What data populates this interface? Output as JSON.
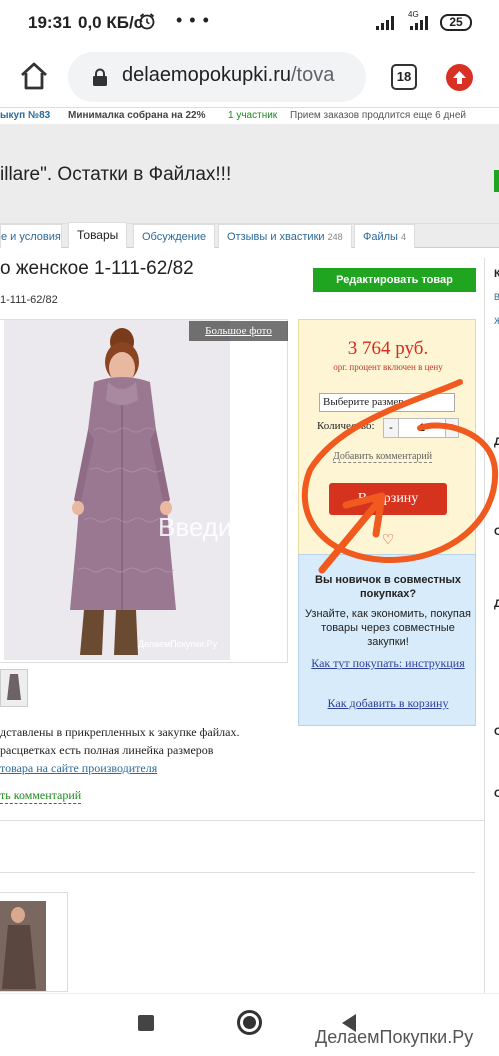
{
  "status": {
    "time": "19:31",
    "speed": "0,0 КБ/с",
    "alarm_icon": "alarm-icon",
    "more_dots": "• • •",
    "network": "4G",
    "battery": "25"
  },
  "browser": {
    "url_host": "delaemopokupki.ru",
    "url_path": "/tova",
    "tabs_count": "18"
  },
  "page": {
    "top_strip": [
      "ыкуп №83",
      "Минималка собрана на 22%",
      "1 участник",
      "Прием заказов продлится еще 6 дней"
    ],
    "purchase_title": "illare\". Остатки в Файлах!!!",
    "tabs": [
      {
        "label": "е и условия",
        "count": ""
      },
      {
        "label": "Товары",
        "count": ""
      },
      {
        "label": "Обсуждение",
        "count": ""
      },
      {
        "label": "Отзывы и хвастики",
        "count": "248"
      },
      {
        "label": "Файлы",
        "count": "4"
      }
    ],
    "product_title": "о женское 1-111-62/82",
    "product_sub": "1-111-62/82",
    "edit_button": "Редактировать товар",
    "big_photo": "Бoльшое фото",
    "photo_watermark": "ДелаемПокупки.Ру",
    "photo_overlay": "Введи...",
    "description_lines": [
      "дставлены в прикрепленных к закупке файлах.",
      "расцветках есть полная линейка размеров"
    ],
    "description_link": "товара на сайте производителя",
    "add_comment_bottom": "ть комментарий",
    "price": {
      "amount": "3 764 руб.",
      "note": "орг. процент включен в цену",
      "size_select": "Выберите размер",
      "qty_label": "Количество:",
      "qty_minus": "-",
      "qty_value": "1",
      "qty_plus": "+",
      "add_comment": "Добавить комментарий",
      "cart_button": "В корзину",
      "heart": "♡"
    },
    "newbie": {
      "title": "Вы новичок в совместных покупках?",
      "text": "Узнайте, как экономить, покупая товары через совместные закупки!",
      "link1": "Как тут покупать: инструкция",
      "link2": "Как добавить в корзину"
    },
    "right_col": {
      "letters": [
        "К",
        "В",
        "Ж",
        "Д",
        "С",
        "Д",
        "С",
        "О"
      ]
    }
  },
  "navbar": {
    "brand": "ДелаемПокупки.Ру"
  },
  "colors": {
    "accent_green": "#1fa51f",
    "price_red": "#d62b1e",
    "annotation_orange": "#f05a1f",
    "link_blue": "#2b6a9a"
  }
}
